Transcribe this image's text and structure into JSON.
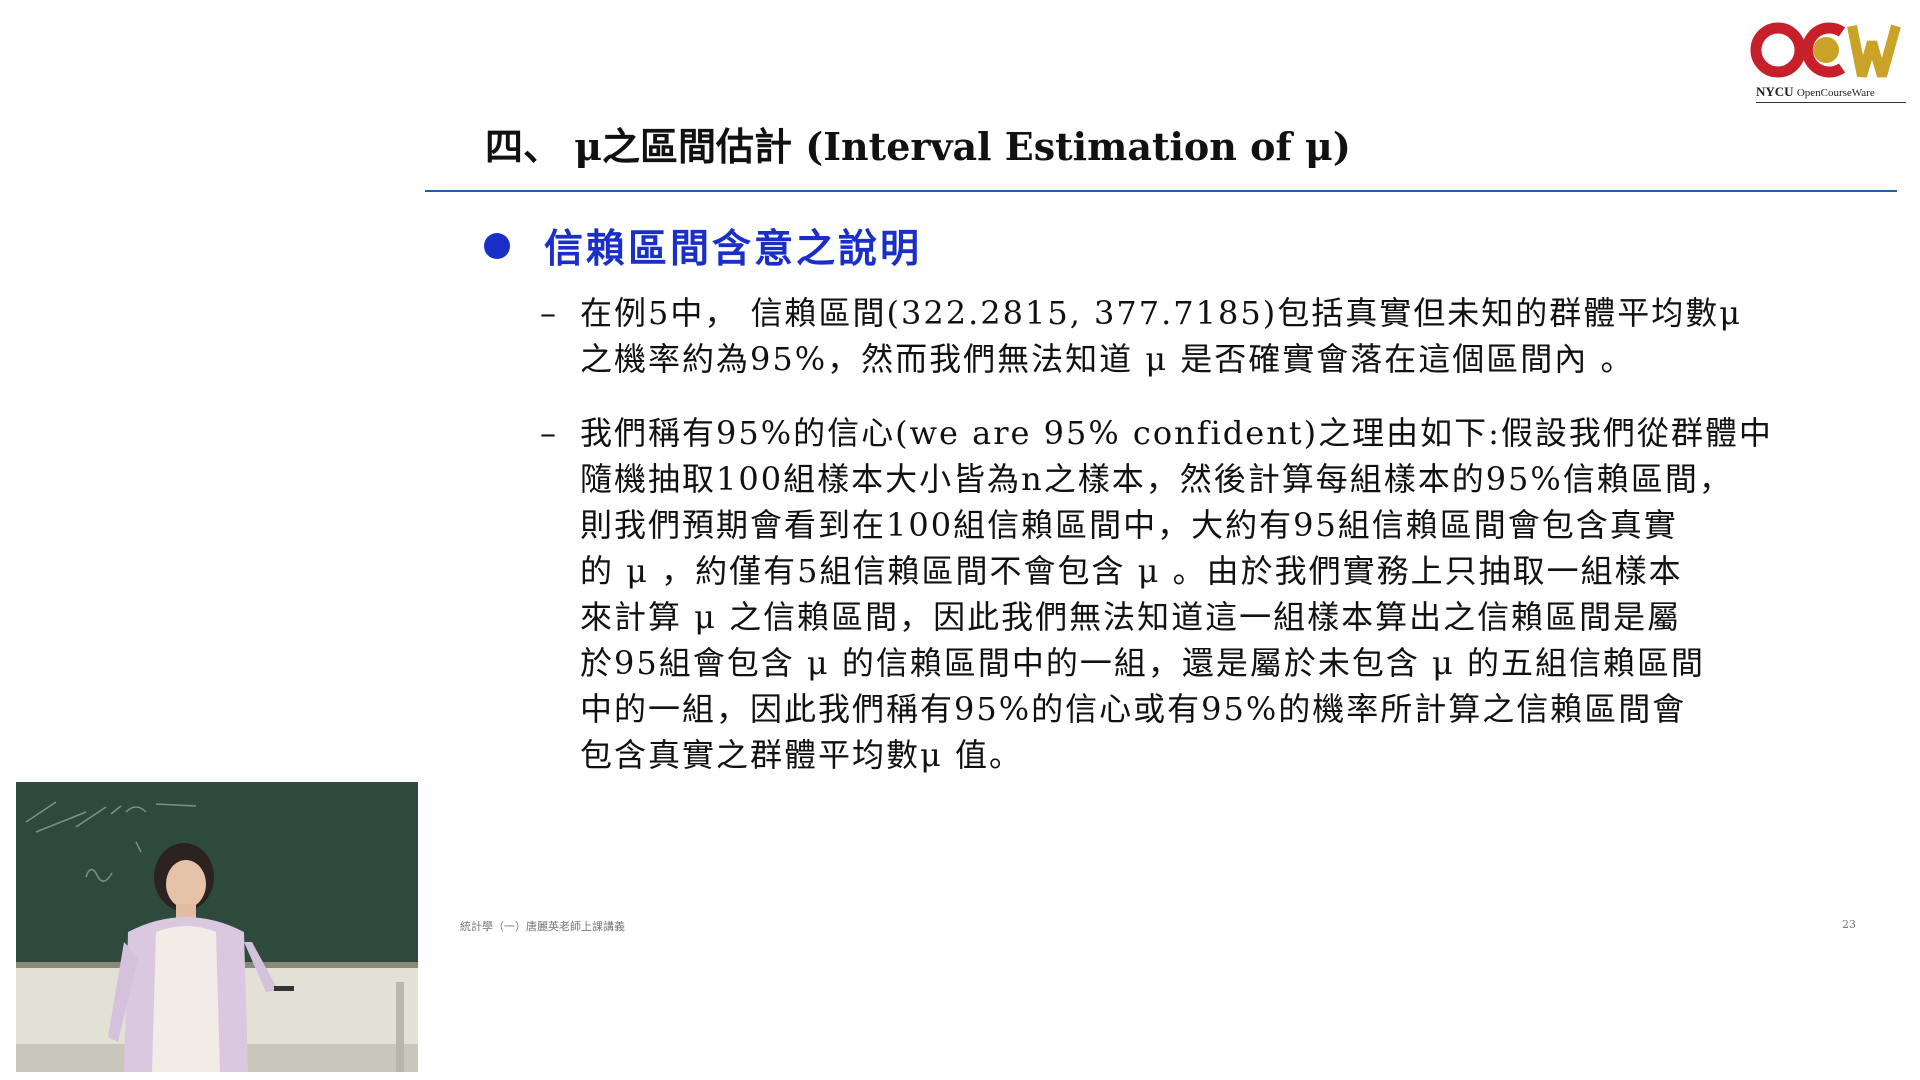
{
  "logo": {
    "letters": "OCW",
    "caption_bold": "NYCU",
    "caption_light": "OpenCourseWare",
    "colors": {
      "red": "#c8202a",
      "gold": "#c9a227"
    }
  },
  "slide": {
    "title": "四、 μ之區間估計 (Interval Estimation of μ)",
    "bullet_heading": "信賴區間含意之說明",
    "items": [
      {
        "dash": "–",
        "lines": [
          "在例5中， 信賴區間(322.2815, 377.7185)包括真實但未知的群體平均數μ",
          "之機率約為95%，然而我們無法知道 μ 是否確實會落在這個區間內 。"
        ]
      },
      {
        "dash": "–",
        "lines": [
          "我們稱有95%的信心(we are 95% confident)之理由如下:假設我們從群體中",
          "隨機抽取100組樣本大小皆為n之樣本，然後計算每組樣本的95%信賴區間，",
          "則我們預期會看到在100組信賴區間中，大約有95組信賴區間會包含真實",
          "的 μ ，約僅有5組信賴區間不會包含 μ 。由於我們實務上只抽取一組樣本",
          "來計算 μ 之信賴區間，因此我們無法知道這一組樣本算出之信賴區間是屬",
          "於95組會包含 μ 的信賴區間中的一組，還是屬於未包含 μ 的五組信賴區間",
          "中的一組，因此我們稱有95%的信心或有95%的機率所計算之信賴區間會",
          "包含真實之群體平均數μ 值。"
        ]
      }
    ],
    "footer_left": "統計學（一）唐麗英老師上課講義",
    "page_number": "23"
  },
  "colors": {
    "bullet_blue": "#1a2fc8",
    "title_rule": "#1f5fa8"
  }
}
